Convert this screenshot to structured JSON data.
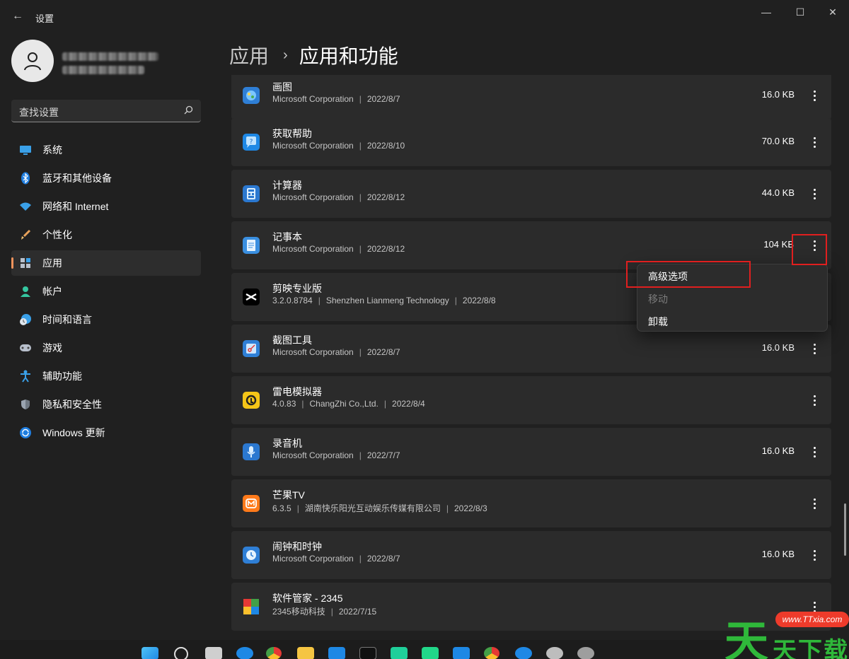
{
  "window": {
    "title": "设置",
    "back_glyph": "←",
    "min_glyph": "—",
    "max_glyph": "☐",
    "close_glyph": "✕"
  },
  "search": {
    "placeholder": "查找设置"
  },
  "nav": [
    {
      "label": "系统",
      "icon": "monitor-icon"
    },
    {
      "label": "蓝牙和其他设备",
      "icon": "bluetooth-icon"
    },
    {
      "label": "网络和 Internet",
      "icon": "wifi-icon"
    },
    {
      "label": "个性化",
      "icon": "brush-icon"
    },
    {
      "label": "应用",
      "icon": "apps-icon",
      "active": true
    },
    {
      "label": "帐户",
      "icon": "person-icon"
    },
    {
      "label": "时间和语言",
      "icon": "clock-globe-icon"
    },
    {
      "label": "游戏",
      "icon": "gamepad-icon"
    },
    {
      "label": "辅助功能",
      "icon": "accessibility-icon"
    },
    {
      "label": "隐私和安全性",
      "icon": "shield-icon"
    },
    {
      "label": "Windows 更新",
      "icon": "update-icon"
    }
  ],
  "breadcrumb": {
    "parent": "应用",
    "separator": "›",
    "current": "应用和功能"
  },
  "apps": [
    {
      "name": "画图",
      "publisher": "Microsoft Corporation",
      "date": "2022/8/7",
      "size": "16.0 KB",
      "icon_color": "#2f7fd6"
    },
    {
      "name": "获取帮助",
      "publisher": "Microsoft Corporation",
      "date": "2022/8/10",
      "size": "70.0 KB",
      "icon_color": "#1e88e5"
    },
    {
      "name": "计算器",
      "publisher": "Microsoft Corporation",
      "date": "2022/8/12",
      "size": "44.0 KB",
      "icon_color": "#2b78d0"
    },
    {
      "name": "记事本",
      "publisher": "Microsoft Corporation",
      "date": "2022/8/12",
      "size": "104 KB",
      "icon_color": "#3a8fe0"
    },
    {
      "name": "剪映专业版",
      "version": "3.2.0.8784",
      "publisher": "Shenzhen Lianmeng Technology",
      "date": "2022/8/8",
      "size": "",
      "icon_color": "#000000"
    },
    {
      "name": "截图工具",
      "publisher": "Microsoft Corporation",
      "date": "2022/8/7",
      "size": "16.0 KB",
      "icon_color": "#2f7fd6"
    },
    {
      "name": "雷电模拟器",
      "version": "4.0.83",
      "publisher": "ChangZhi Co.,Ltd.",
      "date": "2022/8/4",
      "size": "",
      "icon_color": "#f5c518"
    },
    {
      "name": "录音机",
      "publisher": "Microsoft Corporation",
      "date": "2022/7/7",
      "size": "16.0 KB",
      "icon_color": "#2b78d0"
    },
    {
      "name": "芒果TV",
      "version": "6.3.5",
      "publisher": "湖南快乐阳光互动娱乐传媒有限公司",
      "date": "2022/8/3",
      "size": "",
      "icon_color": "#ff7a1a"
    },
    {
      "name": "闹钟和时钟",
      "publisher": "Microsoft Corporation",
      "date": "2022/8/7",
      "size": "16.0 KB",
      "icon_color": "#2f7fd6"
    },
    {
      "name": "软件管家 - 2345",
      "publisher": "2345移动科技",
      "date": "2022/7/15",
      "size": "",
      "icon_color": "#e53935"
    }
  ],
  "menu": {
    "items": [
      {
        "label": "高级选项",
        "enabled": true
      },
      {
        "label": "移动",
        "enabled": false
      },
      {
        "label": "卸载",
        "enabled": true
      }
    ]
  },
  "watermark": {
    "chars": [
      "天",
      "天",
      "下",
      "载"
    ],
    "site": "www.TTxia.com"
  }
}
